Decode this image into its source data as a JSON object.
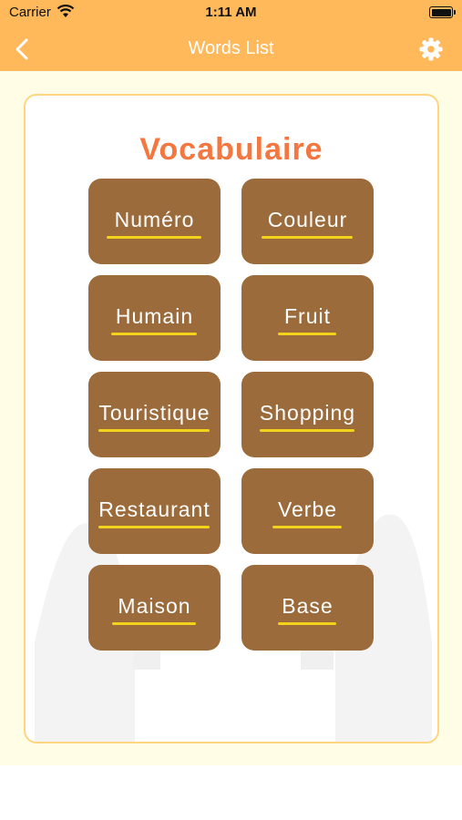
{
  "status_bar": {
    "carrier": "Carrier",
    "time": "1:11 AM"
  },
  "nav": {
    "title": "Words List",
    "back_icon": "chevron-left-icon",
    "settings_icon": "gear-icon"
  },
  "card": {
    "title": "Vocabulaire",
    "categories": [
      "Numéro",
      "Couleur",
      "Humain",
      "Fruit",
      "Touristique",
      "Shopping",
      "Restaurant",
      "Verbe",
      "Maison",
      "Base"
    ]
  },
  "colors": {
    "header_bg": "#ffb85a",
    "page_bg": "#fffde5",
    "card_border": "#ffd67f",
    "title_color": "#f37740",
    "tile_bg": "#9c6b3b",
    "underline": "#f3d21c"
  }
}
